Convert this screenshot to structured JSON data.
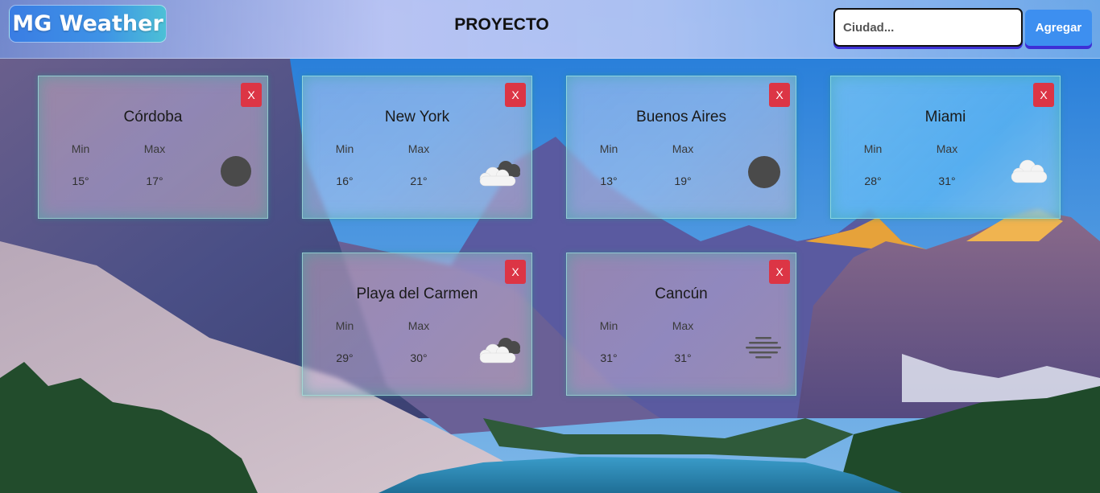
{
  "navbar": {
    "brand": "MG Weather",
    "title": "PROYECTO",
    "search_placeholder": "Ciudad...",
    "add_label": "Agregar"
  },
  "labels": {
    "min": "Min",
    "max": "Max",
    "close": "X"
  },
  "cards": [
    {
      "city": "Córdoba",
      "min": "15°",
      "max": "17°",
      "icon": "dark-circle-icon"
    },
    {
      "city": "New York",
      "min": "16°",
      "max": "21°",
      "icon": "clouds-icon"
    },
    {
      "city": "Buenos Aires",
      "min": "13°",
      "max": "19°",
      "icon": "dark-circle-icon"
    },
    {
      "city": "Miami",
      "min": "28°",
      "max": "31°",
      "icon": "cloud-icon"
    },
    {
      "city": "Playa del Carmen",
      "min": "29°",
      "max": "30°",
      "icon": "clouds-icon"
    },
    {
      "city": "Cancún",
      "min": "31°",
      "max": "31°",
      "icon": "mist-icon"
    }
  ],
  "colors": {
    "close_button": "#dc3545",
    "add_button": "#3d8ff0",
    "brand_gradient_start": "#3a7de4",
    "brand_gradient_end": "#4cc0d6",
    "button_shadow": "#3d2fd6"
  }
}
